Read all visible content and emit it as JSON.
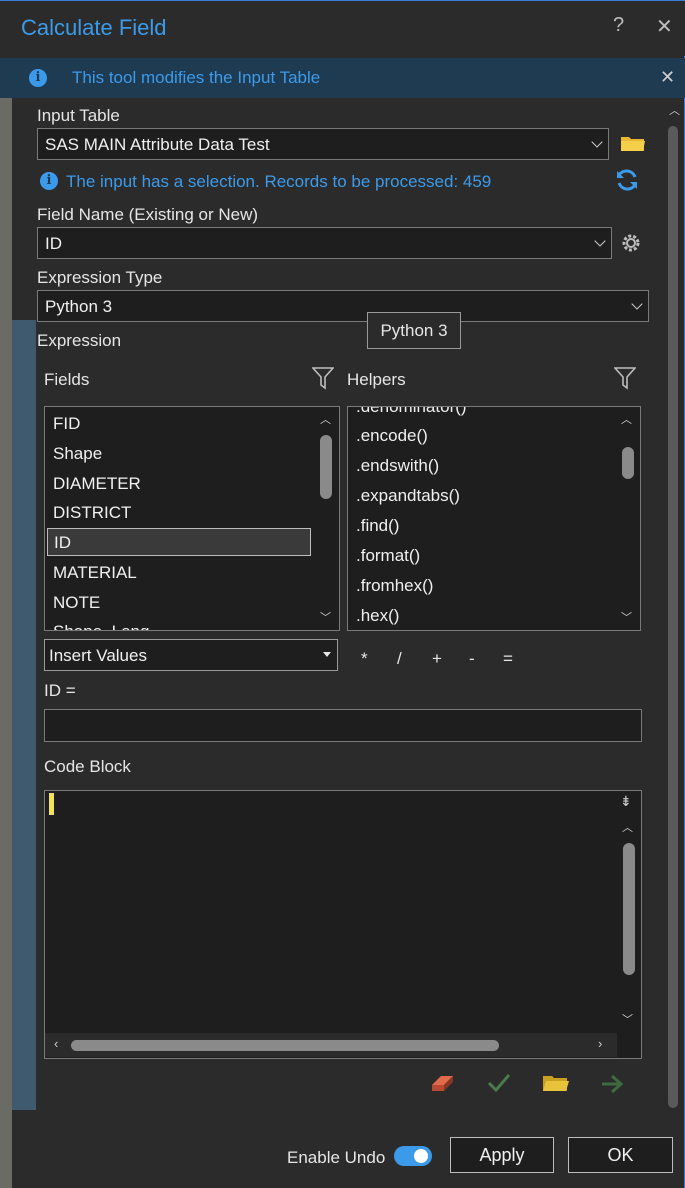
{
  "window": {
    "title": "Calculate Field",
    "help_glyph": "?",
    "close_glyph": "✕"
  },
  "info": {
    "message": "This tool modifies the Input Table",
    "close_glyph": "✕"
  },
  "input_table": {
    "label": "Input Table",
    "value": "SAS MAIN Attribute Data Test",
    "selection_note": "The input has a selection. Records to be processed: 459"
  },
  "field_name": {
    "label": "Field Name (Existing or New)",
    "value": "ID"
  },
  "expression_type": {
    "label": "Expression Type",
    "value": "Python 3",
    "tooltip": "Python 3"
  },
  "expression": {
    "label": "Expression",
    "fields_label": "Fields",
    "helpers_label": "Helpers",
    "fields": [
      "FID",
      "Shape",
      "DIAMETER",
      "DISTRICT",
      "ID",
      "MATERIAL",
      "NOTE",
      "Shape_Leng"
    ],
    "selected_field": "ID",
    "helpers": [
      ".denominator()",
      ".encode()",
      ".endswith()",
      ".expandtabs()",
      ".find()",
      ".format()",
      ".fromhex()",
      ".hex()"
    ],
    "insert_values": "Insert Values",
    "operators": [
      "*",
      "/",
      "+",
      "-",
      "="
    ],
    "expression_label": "ID =",
    "expression_value": ""
  },
  "code_block": {
    "label": "Code Block",
    "value": ""
  },
  "footer": {
    "enable_undo_label": "Enable Undo",
    "enable_undo": true,
    "apply_label": "Apply",
    "ok_label": "OK"
  },
  "colors": {
    "accent": "#3b9bea",
    "background": "#2b2b2b",
    "field_bg": "#1e1e1e",
    "info_bg": "#1f3b52"
  },
  "icons": [
    "info-icon",
    "folder-icon",
    "refresh-icon",
    "gear-icon",
    "filter-icon",
    "eraser-icon",
    "check-icon",
    "folder-open-icon",
    "run-arrow-icon",
    "expand-icon"
  ]
}
